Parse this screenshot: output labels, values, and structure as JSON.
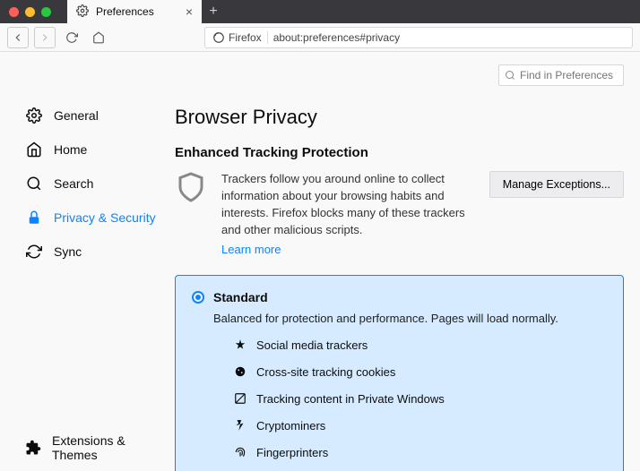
{
  "titlebar": {
    "tab_label": "Preferences"
  },
  "toolbar": {
    "identity_label": "Firefox",
    "url": "about:preferences#privacy"
  },
  "search": {
    "placeholder": "Find in Preferences"
  },
  "sidebar": {
    "items": [
      {
        "label": "General"
      },
      {
        "label": "Home"
      },
      {
        "label": "Search"
      },
      {
        "label": "Privacy & Security"
      },
      {
        "label": "Sync"
      }
    ],
    "bottom": {
      "label": "Extensions & Themes"
    }
  },
  "main": {
    "h1": "Browser Privacy",
    "h2": "Enhanced Tracking Protection",
    "etp_text": "Trackers follow you around online to collect information about your browsing habits and interests. Firefox blocks many of these trackers and other malicious scripts.",
    "learn_more": "Learn more",
    "manage_exceptions": "Manage Exceptions...",
    "option": {
      "title": "Standard",
      "desc": "Balanced for protection and performance. Pages will load normally.",
      "trackers": [
        "Social media trackers",
        "Cross-site tracking cookies",
        "Tracking content in Private Windows",
        "Cryptominers",
        "Fingerprinters"
      ]
    }
  }
}
